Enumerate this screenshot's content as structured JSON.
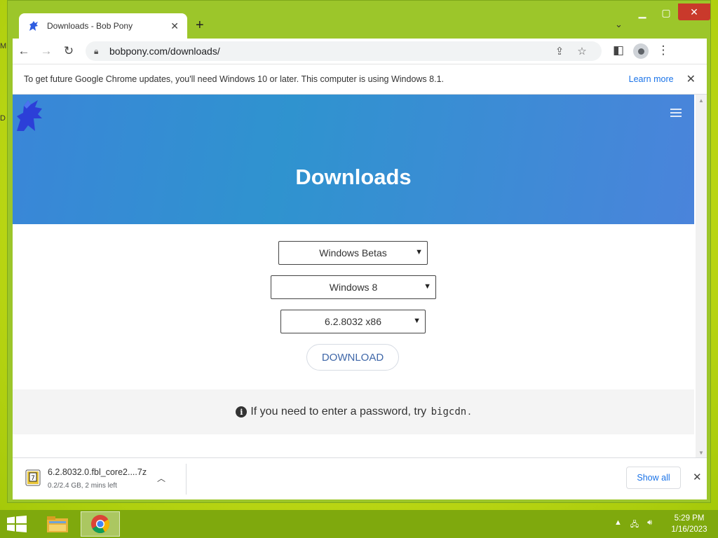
{
  "desktop": {
    "glyph_top": "M",
    "glyph_mid": "D"
  },
  "window": {
    "tab_title": "Downloads - Bob Pony",
    "new_tab": "+",
    "tab_search": "⌄",
    "url": "bobpony.com/downloads/"
  },
  "infobar": {
    "message": "To get future Google Chrome updates, you'll need Windows 10 or later. This computer is using Windows 8.1.",
    "learn_more": "Learn more"
  },
  "page": {
    "hero_title": "Downloads",
    "select_category": "Windows Betas",
    "select_version": "Windows 8",
    "select_build": "6.2.8032 x86",
    "download_button": "DOWNLOAD",
    "notice_text": "If you need to enter a password, try",
    "notice_code": "bigcdn",
    "notice_end": "."
  },
  "download_shelf": {
    "file_name": "6.2.8032.0.fbl_core2....7z",
    "status": "0.2/2.4 GB, 2 mins left",
    "show_all": "Show all"
  },
  "taskbar": {
    "time": "5:29 PM",
    "date": "1/16/2023"
  },
  "colors": {
    "hero_blue": "#3a86d8",
    "chrome_frame": "#9cc62a",
    "link_blue": "#1a73e8"
  }
}
